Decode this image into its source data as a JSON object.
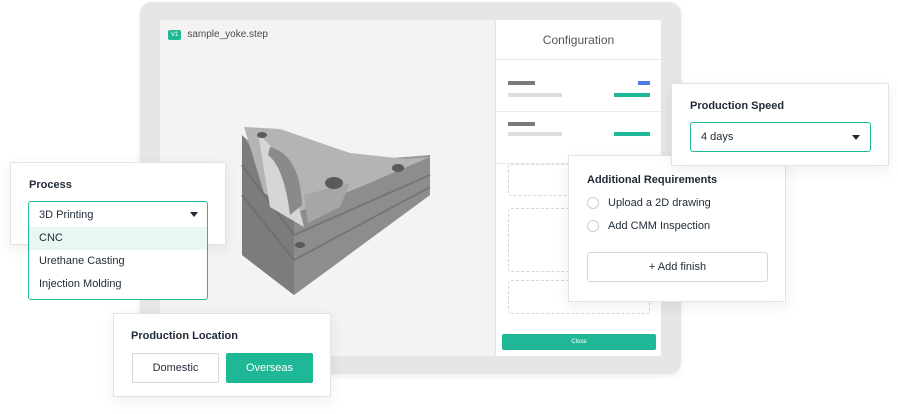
{
  "viewer": {
    "file_badge": "V1",
    "file_name": "sample_yoke.step"
  },
  "configuration": {
    "title": "Configuration",
    "close_label": "Close"
  },
  "process": {
    "title": "Process",
    "selected": "3D Printing",
    "options": [
      "CNC",
      "Urethane Casting",
      "Injection Molding"
    ]
  },
  "production_location": {
    "title": "Production Location",
    "options": [
      "Domestic",
      "Overseas"
    ],
    "selected": "Overseas"
  },
  "production_speed": {
    "title": "Production Speed",
    "selected": "4 days"
  },
  "additional_requirements": {
    "title": "Additional Requirements",
    "items": [
      "Upload a 2D drawing",
      "Add CMM Inspection"
    ],
    "add_finish_label": "+ Add finish"
  },
  "colors": {
    "accent": "#1fb896",
    "accent_light": "#e9f6f1",
    "blue_marker": "#4f7be0"
  },
  "icons": [
    "chevron-down-icon",
    "radio-icon"
  ]
}
